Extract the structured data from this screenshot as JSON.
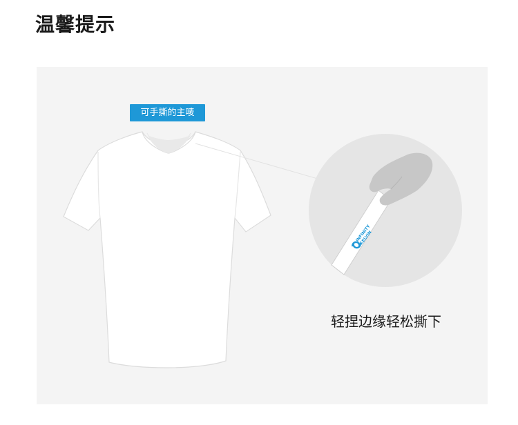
{
  "page": {
    "title": "温馨提示"
  },
  "label": {
    "text": "可手撕的主唛"
  },
  "caption": {
    "text": "轻捏边缘轻松撕下"
  },
  "brand": {
    "name": "INFINITY\nKELVIN"
  },
  "colors": {
    "accent": "#1e98d7",
    "panel": "#f4f4f4",
    "circle": "#e5e5e5",
    "hand": "#c7c7c7"
  }
}
